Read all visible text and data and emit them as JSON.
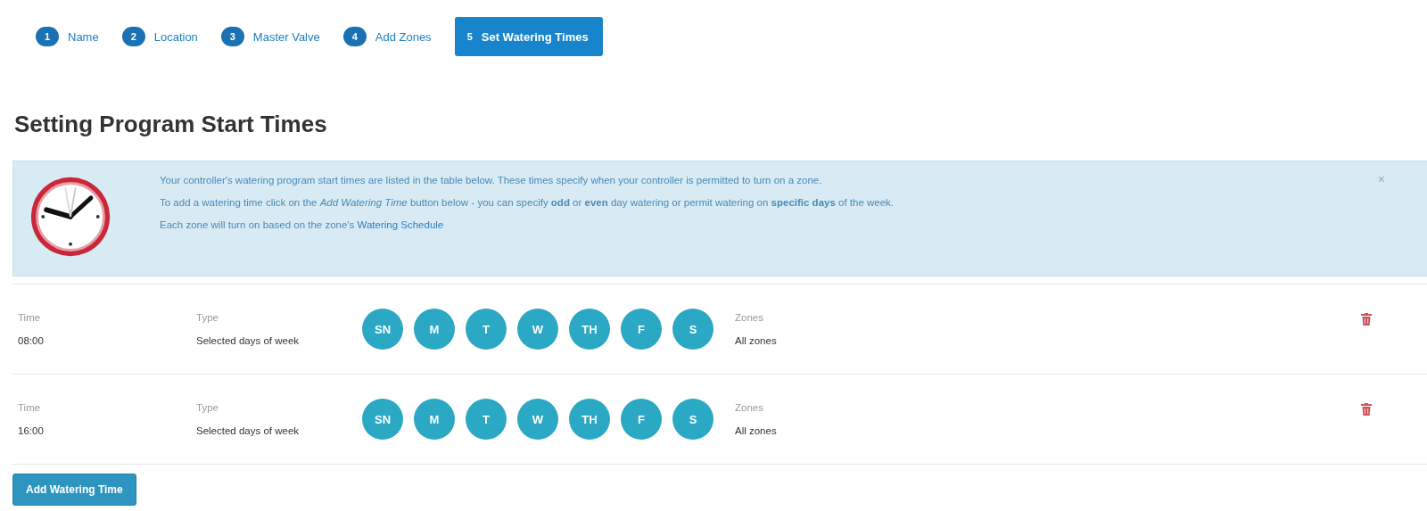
{
  "steps": [
    {
      "number": "1",
      "label": "Name",
      "selected": false
    },
    {
      "number": "2",
      "label": "Location",
      "selected": false
    },
    {
      "number": "3",
      "label": "Master Valve",
      "selected": false
    },
    {
      "number": "4",
      "label": "Add Zones",
      "selected": false
    },
    {
      "number": "5",
      "label": "Set Watering Times",
      "selected": true
    }
  ],
  "heading": "Setting Program Start Times",
  "alert": {
    "paragraphs": [
      "Your controller's watering program start times are listed in the table below. These times specify when your controller is permitted to turn on a zone.",
      "To add a watering time click on the *Add Watering Time* button below - you can specify **odd** or **even** day watering or permit watering on **specific days** of the week."
    ],
    "last_text": "Each zone will turn on based on the zone's",
    "last_link": "Watering Schedule",
    "close": "×"
  },
  "rows": [
    {
      "time_label": "Time",
      "time": "08:00",
      "type_label": "Type",
      "type": "Selected days of week",
      "days": [
        {
          "label": "SN",
          "selected": true
        },
        {
          "label": "M",
          "selected": true
        },
        {
          "label": "T",
          "selected": true
        },
        {
          "label": "W",
          "selected": true
        },
        {
          "label": "TH",
          "selected": true
        },
        {
          "label": "F",
          "selected": true
        },
        {
          "label": "S",
          "selected": true
        }
      ],
      "zones_label": "Zones",
      "zones": "All zones"
    },
    {
      "time_label": "Time",
      "time": "16:00",
      "type_label": "Type",
      "type": "Selected days of week",
      "days": [
        {
          "label": "SN",
          "selected": true
        },
        {
          "label": "M",
          "selected": true
        },
        {
          "label": "T",
          "selected": true
        },
        {
          "label": "W",
          "selected": true
        },
        {
          "label": "TH",
          "selected": true
        },
        {
          "label": "F",
          "selected": true
        },
        {
          "label": "S",
          "selected": true
        }
      ],
      "zones_label": "Zones",
      "zones": "All zones"
    }
  ],
  "add_button": "Add Watering Time"
}
